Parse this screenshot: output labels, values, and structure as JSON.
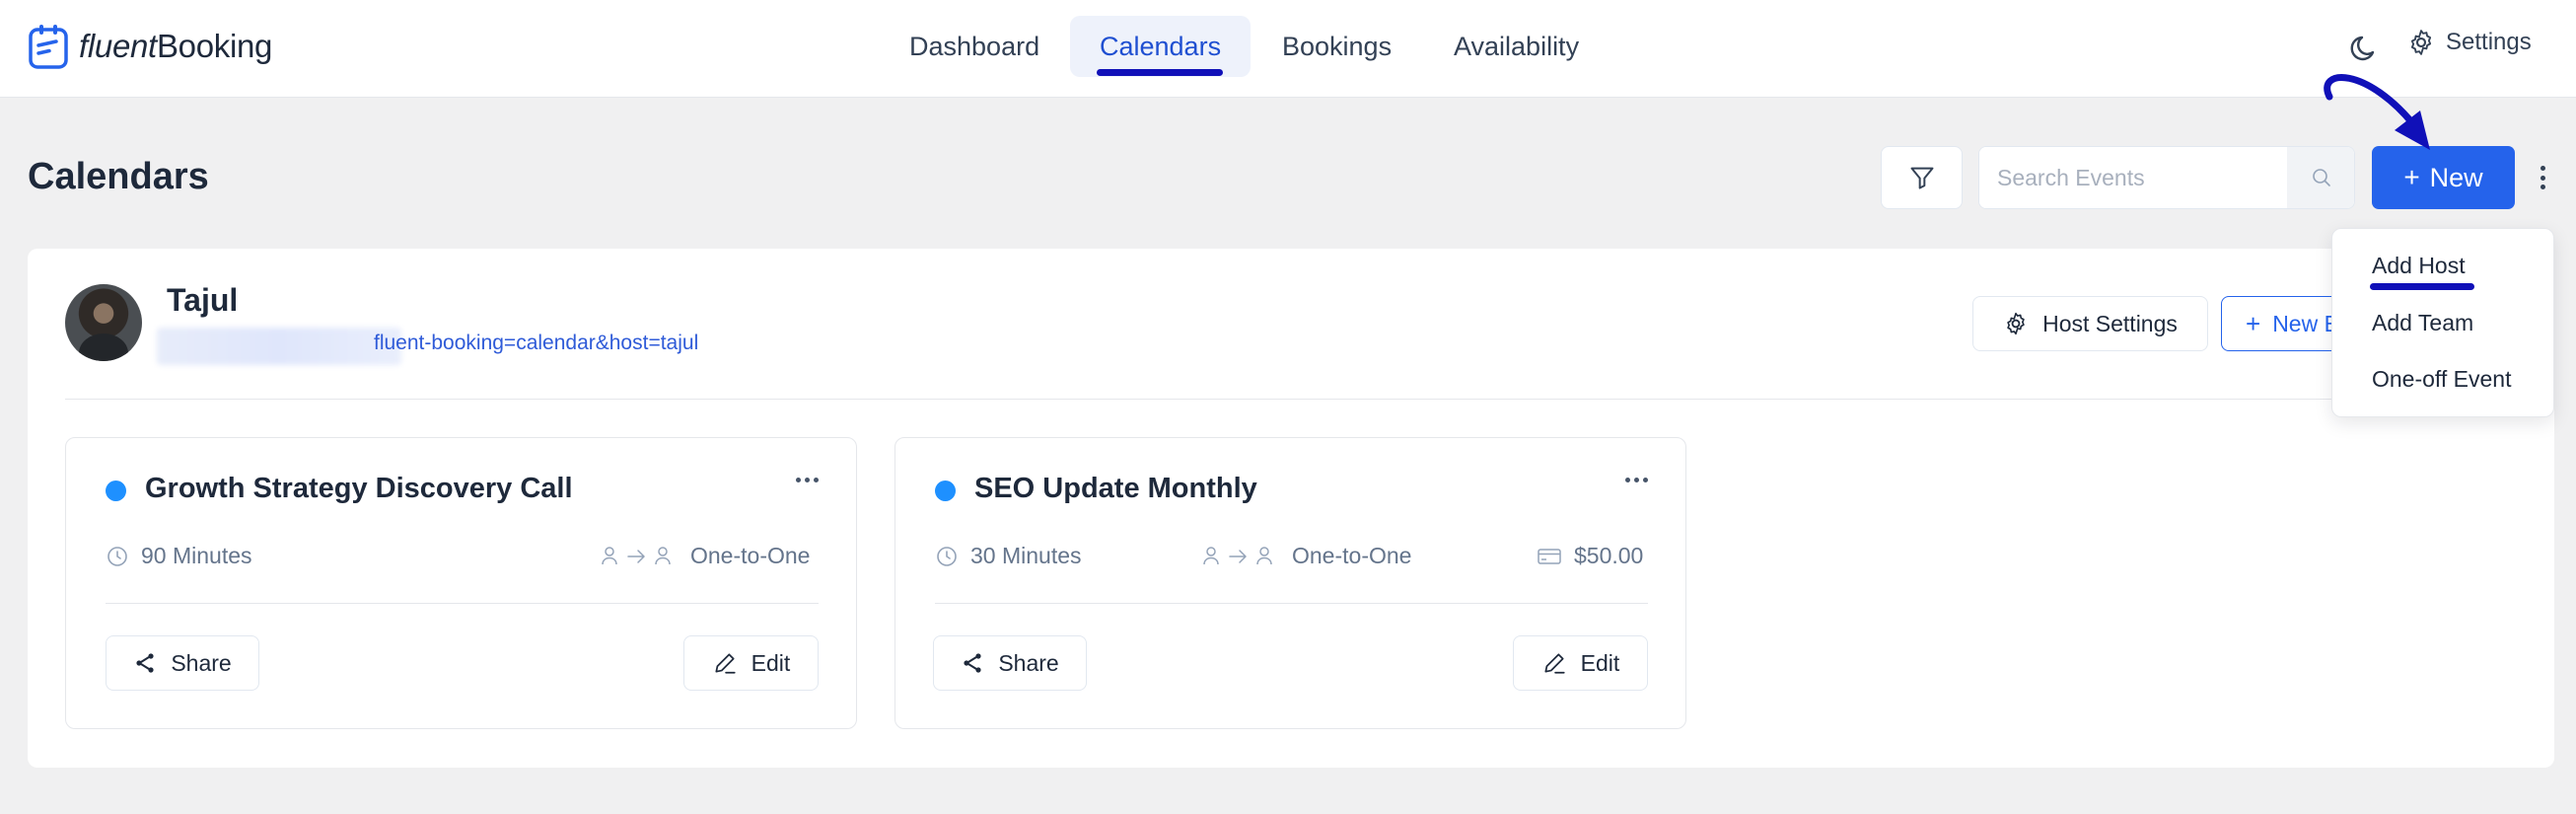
{
  "brand": {
    "name_part1": "fluent",
    "name_part2": "Booking",
    "accent": "#2563eb"
  },
  "nav": {
    "items": [
      {
        "label": "Dashboard",
        "active": false
      },
      {
        "label": "Calendars",
        "active": true
      },
      {
        "label": "Bookings",
        "active": false
      },
      {
        "label": "Availability",
        "active": false
      }
    ],
    "theme_icon": "moon-icon",
    "settings_label": "Settings"
  },
  "page": {
    "title": "Calendars",
    "search_placeholder": "Search Events",
    "new_button_label": "New"
  },
  "host": {
    "name": "Tajul",
    "url_visible": "fluent-booking=calendar&host=tajul",
    "settings_button": "Host Settings",
    "new_event_button": "New E"
  },
  "events": [
    {
      "title": "Growth Strategy Discovery Call",
      "color": "#1e90ff",
      "duration": "90 Minutes",
      "type": "One-to-One",
      "price": null,
      "share_label": "Share",
      "edit_label": "Edit"
    },
    {
      "title": "SEO Update Monthly",
      "color": "#1e90ff",
      "duration": "30 Minutes",
      "type": "One-to-One",
      "price": "$50.00",
      "share_label": "Share",
      "edit_label": "Edit"
    }
  ],
  "new_menu": {
    "items": [
      "Add Host",
      "Add Team",
      "One-off Event"
    ],
    "highlighted": "Add Host"
  },
  "annotation_color": "#1010b8"
}
